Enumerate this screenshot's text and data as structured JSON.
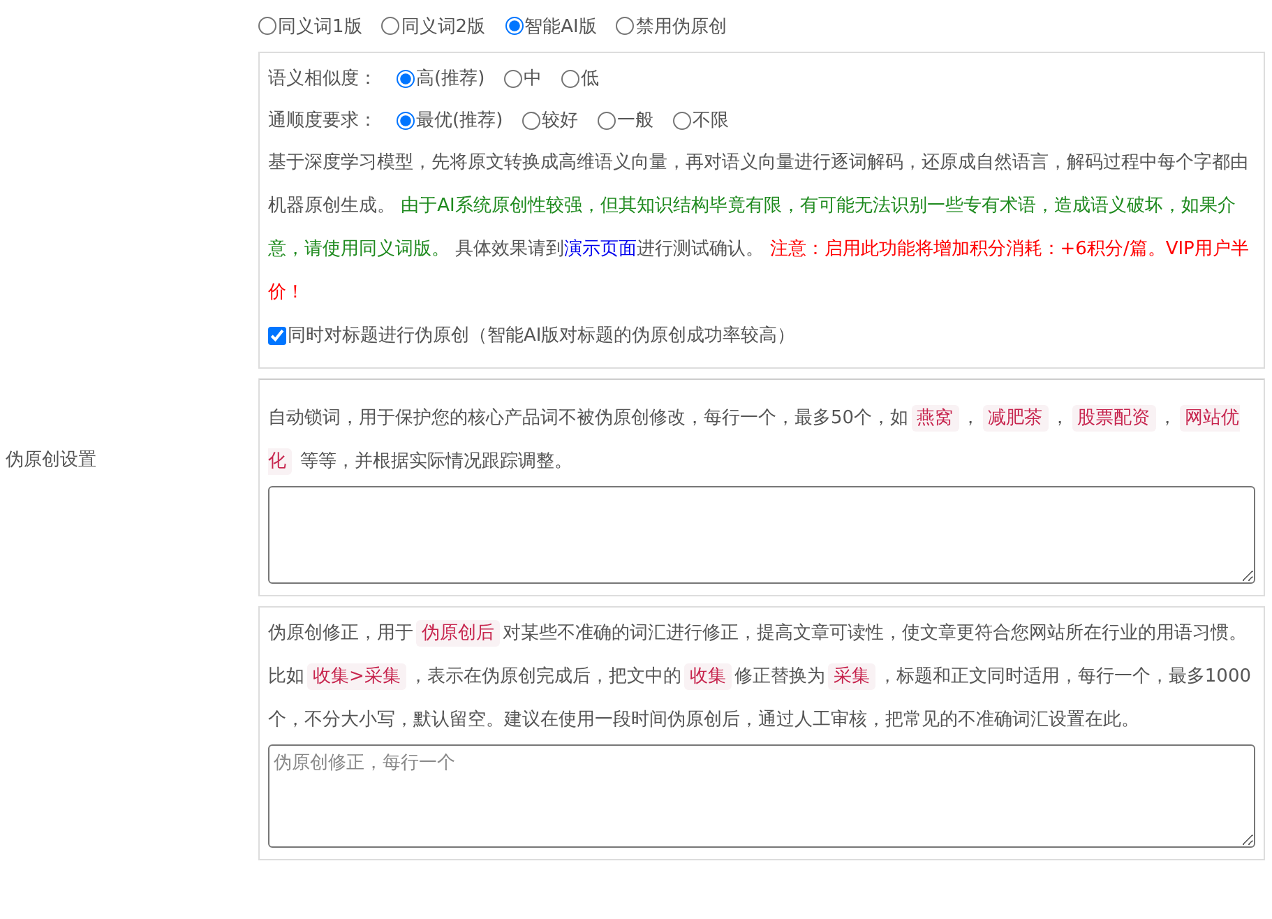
{
  "side_label": "伪原创设置",
  "mode_options": [
    {
      "label": "同义词1版",
      "selected": false
    },
    {
      "label": "同义词2版",
      "selected": false
    },
    {
      "label": "智能AI版",
      "selected": true
    },
    {
      "label": "禁用伪原创",
      "selected": false
    }
  ],
  "ai_panel": {
    "similarity": {
      "label": "语义相似度：",
      "options": [
        {
          "label": "高(推荐)",
          "selected": true
        },
        {
          "label": "中",
          "selected": false
        },
        {
          "label": "低",
          "selected": false
        }
      ]
    },
    "fluency": {
      "label": "通顺度要求：",
      "options": [
        {
          "label": "最优(推荐)",
          "selected": true
        },
        {
          "label": "较好",
          "selected": false
        },
        {
          "label": "一般",
          "selected": false
        },
        {
          "label": "不限",
          "selected": false
        }
      ]
    },
    "description": [
      {
        "kind": "plain",
        "text": "基于深度学习模型，先将原文转换成高维语义向量，再对语义向量进行逐词解码，还原成自然语言，解码过程中每个字都由机器原创生成。 "
      },
      {
        "kind": "success",
        "text": "由于AI系统原创性较强，但其知识结构毕竟有限，有可能无法识别一些专有术语，造成语义破坏，如果介意，请使用同义词版。"
      },
      {
        "kind": "plain",
        "text": " 具体效果请到"
      },
      {
        "kind": "link",
        "text": "演示页面"
      },
      {
        "kind": "plain",
        "text": "进行测试确认。 "
      },
      {
        "kind": "warning",
        "text": "注意：启用此功能将增加积分消耗：+6积分/篇。VIP用户半价！"
      }
    ],
    "title_option": {
      "label": "同时对标题进行伪原创（智能AI版对标题的伪原创成功率较高）",
      "checked": true
    }
  },
  "lock_words": {
    "description": [
      {
        "kind": "plain",
        "text": "自动锁词，用于保护您的核心产品词不被伪原创修改，每行一个，最多50个，如"
      },
      {
        "kind": "code",
        "text": "燕窝"
      },
      {
        "kind": "plain",
        "text": "，"
      },
      {
        "kind": "code",
        "text": "减肥茶"
      },
      {
        "kind": "plain",
        "text": "，"
      },
      {
        "kind": "code",
        "text": "股票配资"
      },
      {
        "kind": "plain",
        "text": "，"
      },
      {
        "kind": "code",
        "text": "网站优化"
      },
      {
        "kind": "plain",
        "text": " 等等，并根据实际情况跟踪调整。"
      }
    ]
  },
  "corrections": {
    "description": [
      {
        "kind": "plain",
        "text": "伪原创修正，用于"
      },
      {
        "kind": "code",
        "text": "伪原创后"
      },
      {
        "kind": "plain",
        "text": "对某些不准确的词汇进行修正，提高文章可读性，使文章更符合您网站所在行业的用语习惯。比如"
      },
      {
        "kind": "code",
        "text": "收集>采集"
      },
      {
        "kind": "plain",
        "text": "，表示在伪原创完成后，把文中的"
      },
      {
        "kind": "code",
        "text": "收集"
      },
      {
        "kind": "plain",
        "text": "修正替换为"
      },
      {
        "kind": "code",
        "text": "采集"
      },
      {
        "kind": "plain",
        "text": "，标题和正文同时适用，每行一个，最多1000个，不分大小写，默认留空。建议在使用一段时间伪原创后，通过人工审核，把常见的不准确词汇设置在此。"
      }
    ],
    "placeholder": "伪原创修正，每行一个"
  }
}
